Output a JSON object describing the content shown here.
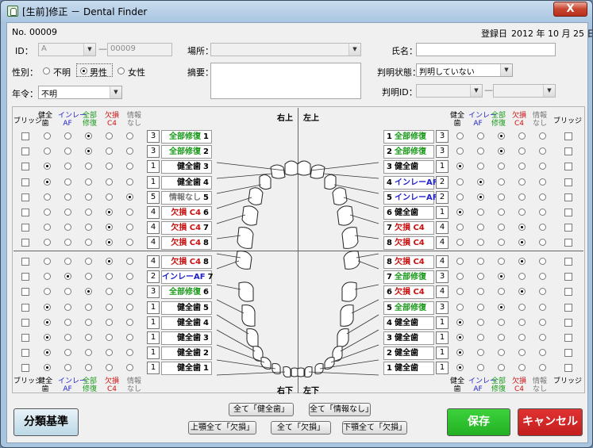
{
  "window": {
    "title": "[生前]修正 － Dental Finder",
    "close": "X"
  },
  "header": {
    "no_label": "No.",
    "no_value": "00009",
    "reg_label": "登録日",
    "reg_value": "2012 年 10 月 25 日"
  },
  "form": {
    "id_label": "ID：",
    "id_prefix": "A",
    "id_value": "00009",
    "place_label": "場所：",
    "place_value": "",
    "name_label": "氏名：",
    "name_value": "",
    "sex_label": "性別：",
    "sex_options": [
      "不明",
      "男性",
      "女性"
    ],
    "sex_selected": "男性",
    "summary_label": "摘要：",
    "summary_value": "",
    "status_label": "判明状態：",
    "status_value": "判明していない",
    "age_label": "年令：",
    "age_value": "不明",
    "judge_id_label": "判明ID：",
    "judge_id_value": "",
    "judge_id_value2": ""
  },
  "columns": {
    "bridge": "ブリッジ",
    "healthy": "健全\n歯",
    "inlay": "インレー\nAF",
    "full": "全部\n修復",
    "missing": "欠損\nC4",
    "noinfo": "情報\nなし"
  },
  "colors": {
    "healthy": "#000000",
    "inlay": "#2222cc",
    "full": "#1a9a1a",
    "missing": "#cc1111",
    "noinfo": "#777777"
  },
  "quadrants": {
    "upper_right": "右上",
    "upper_left": "左上",
    "lower_right": "右下",
    "lower_left": "左下"
  },
  "upper_right": [
    {
      "num": "1",
      "value": "3",
      "label": "全部修復",
      "status": "full"
    },
    {
      "num": "2",
      "value": "3",
      "label": "全部修復",
      "status": "full"
    },
    {
      "num": "3",
      "value": "1",
      "label": "健全歯",
      "status": "healthy"
    },
    {
      "num": "4",
      "value": "1",
      "label": "健全歯",
      "status": "healthy"
    },
    {
      "num": "5",
      "value": "5",
      "label": "情報なし",
      "status": "noinfo"
    },
    {
      "num": "6",
      "value": "4",
      "label": "欠損 C4",
      "status": "missing"
    },
    {
      "num": "7",
      "value": "4",
      "label": "欠損 C4",
      "status": "missing"
    },
    {
      "num": "8",
      "value": "4",
      "label": "欠損 C4",
      "status": "missing"
    }
  ],
  "upper_left": [
    {
      "num": "1",
      "value": "3",
      "label": "全部修復",
      "status": "full"
    },
    {
      "num": "2",
      "value": "3",
      "label": "全部修復",
      "status": "full"
    },
    {
      "num": "3",
      "value": "1",
      "label": "健全歯",
      "status": "healthy"
    },
    {
      "num": "4",
      "value": "2",
      "label": "インレーAF",
      "status": "inlay"
    },
    {
      "num": "5",
      "value": "2",
      "label": "インレーAF",
      "status": "inlay"
    },
    {
      "num": "6",
      "value": "1",
      "label": "健全歯",
      "status": "healthy"
    },
    {
      "num": "7",
      "value": "4",
      "label": "欠損 C4",
      "status": "missing"
    },
    {
      "num": "8",
      "value": "4",
      "label": "欠損 C4",
      "status": "missing"
    }
  ],
  "lower_right": [
    {
      "num": "8",
      "value": "4",
      "label": "欠損 C4",
      "status": "missing"
    },
    {
      "num": "7",
      "value": "2",
      "label": "インレーAF",
      "status": "inlay"
    },
    {
      "num": "6",
      "value": "3",
      "label": "全部修復",
      "status": "full"
    },
    {
      "num": "5",
      "value": "1",
      "label": "健全歯",
      "status": "healthy"
    },
    {
      "num": "4",
      "value": "1",
      "label": "健全歯",
      "status": "healthy"
    },
    {
      "num": "3",
      "value": "1",
      "label": "健全歯",
      "status": "healthy"
    },
    {
      "num": "2",
      "value": "1",
      "label": "健全歯",
      "status": "healthy"
    },
    {
      "num": "1",
      "value": "1",
      "label": "健全歯",
      "status": "healthy"
    }
  ],
  "lower_left": [
    {
      "num": "8",
      "value": "4",
      "label": "欠損 C4",
      "status": "missing"
    },
    {
      "num": "7",
      "value": "3",
      "label": "全部修復",
      "status": "full"
    },
    {
      "num": "6",
      "value": "4",
      "label": "欠損 C4",
      "status": "missing"
    },
    {
      "num": "5",
      "value": "3",
      "label": "全部修復",
      "status": "full"
    },
    {
      "num": "4",
      "value": "1",
      "label": "健全歯",
      "status": "healthy"
    },
    {
      "num": "3",
      "value": "1",
      "label": "健全歯",
      "status": "healthy"
    },
    {
      "num": "2",
      "value": "1",
      "label": "健全歯",
      "status": "healthy"
    },
    {
      "num": "1",
      "value": "1",
      "label": "健全歯",
      "status": "healthy"
    }
  ],
  "buttons": {
    "classification": "分類基準",
    "all_healthy": "全て「健全歯」",
    "all_noinfo": "全て「情報なし」",
    "upper_missing": "上顎全て「欠損」",
    "all_missing": "全て「欠損」",
    "lower_missing": "下顎全て「欠損」",
    "save": "保存",
    "cancel": "キャンセル"
  }
}
